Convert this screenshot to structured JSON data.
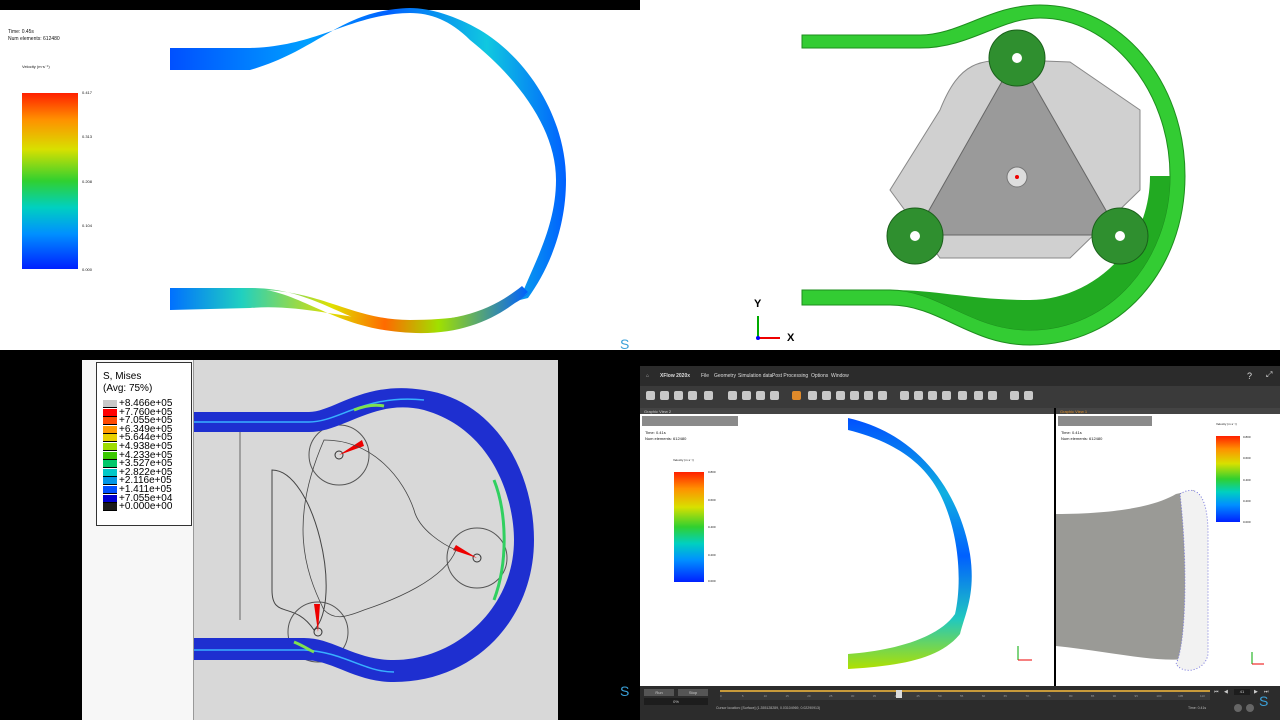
{
  "q1": {
    "time": "Time: 0.45s",
    "num_elements": "Num elements: 612480",
    "legend_title": "Velocity (m·s⁻¹)",
    "legend_values": [
      "0.417",
      "0.313",
      "0.208",
      "0.104",
      "0.000"
    ]
  },
  "q2": {
    "axis_y": "Y",
    "axis_x": "X"
  },
  "q3": {
    "legend_title": "S, Mises",
    "legend_subtitle": "(Avg: 75%)",
    "legend_values": [
      "+8.466e+05",
      "+7.760e+05",
      "+7.055e+05",
      "+6.349e+05",
      "+5.644e+05",
      "+4.938e+05",
      "+4.233e+05",
      "+3.527e+05",
      "+2.822e+05",
      "+2.116e+05",
      "+1.411e+05",
      "+7.055e+04",
      "+0.000e+00"
    ],
    "legend_colors": [
      "#c8c8c8",
      "#ff0000",
      "#ff4a00",
      "#ff9a00",
      "#e8d000",
      "#9fdc00",
      "#3cc800",
      "#00c86a",
      "#00c8c8",
      "#0096e6",
      "#0050ff",
      "#0000d0",
      "#1a1a1a"
    ]
  },
  "q4": {
    "app_title": "XFlow 2020x",
    "menu": [
      "File",
      "Geometry",
      "Simulation data",
      "Post Processing",
      "Options",
      "Window"
    ],
    "view_left_title": "Graphic View 2",
    "view_right_title": "Graphic View 1",
    "time": "Time: 0.41s",
    "num_elements": "Num elements: 612480",
    "legend_title": "Velocity (m·s⁻¹)",
    "legend_values": [
      "0.800",
      "0.600",
      "0.400",
      "0.200",
      "0.000"
    ],
    "status_button_1": "Run",
    "status_button_2": "Stop",
    "progress_label": "0%",
    "cursor_location": "Cursor location: [Surface] (1.355128289, 0.03104969, 0.02290913)",
    "time_readout": "Time: 0.41s",
    "frame_number": "41",
    "timeline_ticks": [
      "0",
      "5",
      "10",
      "15",
      "20",
      "25",
      "30",
      "35",
      "40",
      "45",
      "50",
      "55",
      "60",
      "65",
      "70",
      "75",
      "80",
      "85",
      "90",
      "95",
      "100",
      "105",
      "110"
    ]
  },
  "watermark": "S"
}
